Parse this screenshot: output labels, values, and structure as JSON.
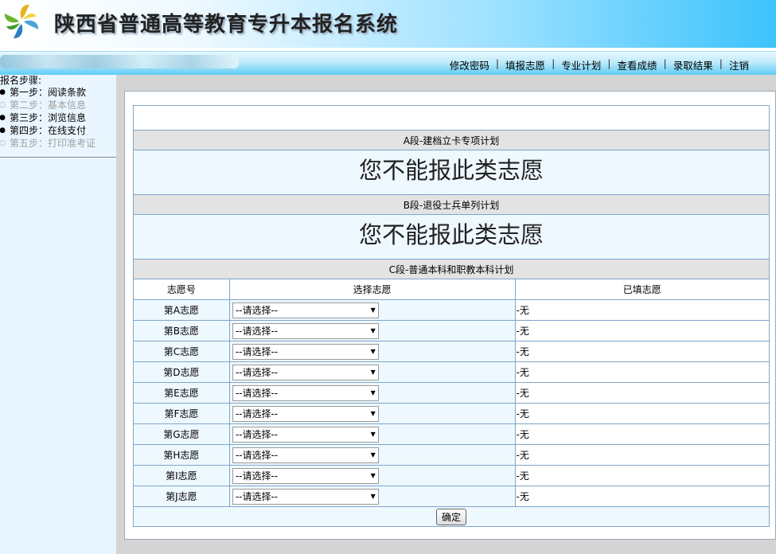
{
  "header": {
    "title": "陕西省普通高等教育专升本报名系统",
    "colors": {
      "gradient_end": "#3cc3fb"
    }
  },
  "nav": {
    "links": [
      "修改密码",
      "填报志愿",
      "专业计划",
      "查看成绩",
      "录取结果",
      "注销"
    ]
  },
  "sidebar": {
    "steps_title": "报名步骤:",
    "steps": [
      {
        "label": "第一步：阅读条款",
        "state": "done"
      },
      {
        "label": "第二步：基本信息",
        "state": "pending"
      },
      {
        "label": "第三步：浏览信息",
        "state": "done"
      },
      {
        "label": "第四步：在线支付",
        "state": "done"
      },
      {
        "label": "第五步：打印准考证",
        "state": "pending"
      }
    ]
  },
  "sections": {
    "a": {
      "title": "A段-建档立卡专项计划",
      "message": "您不能报此类志愿"
    },
    "b": {
      "title": "B段-退役士兵单列计划",
      "message": "您不能报此类志愿"
    },
    "c": {
      "title": "C段-普通本科和职教本科计划"
    }
  },
  "table": {
    "headers": [
      "志愿号",
      "选择志愿",
      "已填志愿"
    ],
    "select_placeholder": "--请选择--",
    "rows": [
      {
        "no": "第A志愿",
        "filled": "-无"
      },
      {
        "no": "第B志愿",
        "filled": "-无"
      },
      {
        "no": "第C志愿",
        "filled": "-无"
      },
      {
        "no": "第D志愿",
        "filled": "-无"
      },
      {
        "no": "第E志愿",
        "filled": "-无"
      },
      {
        "no": "第F志愿",
        "filled": "-无"
      },
      {
        "no": "第G志愿",
        "filled": "-无"
      },
      {
        "no": "第H志愿",
        "filled": "-无"
      },
      {
        "no": "第I志愿",
        "filled": "-无"
      },
      {
        "no": "第J志愿",
        "filled": "-无"
      }
    ],
    "submit_label": "确定"
  }
}
